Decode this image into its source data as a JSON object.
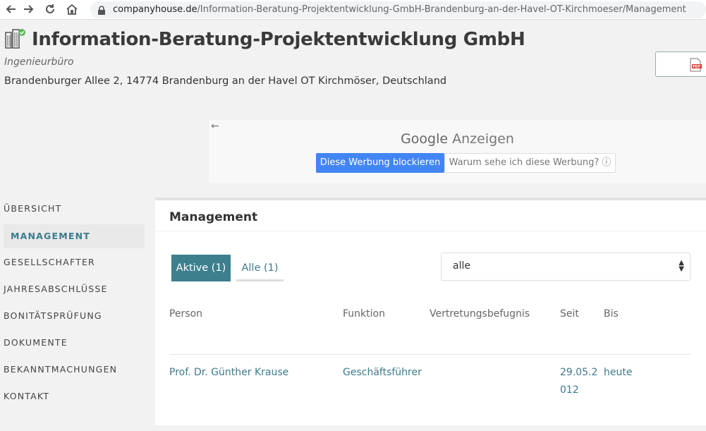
{
  "browser": {
    "url_host": "companyhouse.de",
    "url_path": "/Information-Beratung-Projektentwicklung-GmbH-Brandenburg-an-der-Havel-OT-Kirchmoeser/Management",
    "icons": [
      "back-arrow-icon",
      "forward-arrow-icon",
      "reload-icon",
      "home-icon",
      "lock-icon"
    ]
  },
  "header": {
    "company_name": "Information-Beratung-Projektentwicklung GmbH",
    "company_type": "Ingenieurbüro",
    "address": "Brandenburger Allee 2, 14774 Brandenburg an der Havel OT Kirchmöser, Deutschland",
    "pdf_icon": "pdf-icon"
  },
  "ad": {
    "back": "←",
    "brand": "Google",
    "label": "Anzeigen",
    "block_button": "Diese Werbung blockieren",
    "why_button": "Warum sehe ich diese Werbung? ⓘ"
  },
  "sidebar": {
    "items": [
      {
        "label": "ÜBERSICHT"
      },
      {
        "label": "MANAGEMENT"
      },
      {
        "label": "GESELLSCHAFTER"
      },
      {
        "label": "JAHRESABSCHLÜSSE"
      },
      {
        "label": "BONITÄTSPRÜFUNG"
      },
      {
        "label": "DOKUMENTE"
      },
      {
        "label": "BEKANNTMACHUNGEN"
      },
      {
        "label": "KONTAKT"
      }
    ],
    "active_index": 1
  },
  "main": {
    "heading": "Management",
    "tabs": [
      {
        "label": "Aktive (1)",
        "active": true
      },
      {
        "label": "Alle (1)",
        "active": false
      }
    ],
    "filter": {
      "value": "alle"
    },
    "table": {
      "columns": [
        "Person",
        "Funktion",
        "Vertretungsbefugnis",
        "Seit",
        "Bis"
      ],
      "rows": [
        {
          "person": "Prof. Dr. Günther Krause",
          "funktion": "Geschäftsführer",
          "vertretung": "",
          "seit": "29.05.2012",
          "bis": "heute"
        }
      ]
    }
  },
  "colors": {
    "accent": "#3d7f8d",
    "link": "#3d7a8c",
    "ad_button": "#4285f4",
    "background": "#f2f2f2"
  }
}
